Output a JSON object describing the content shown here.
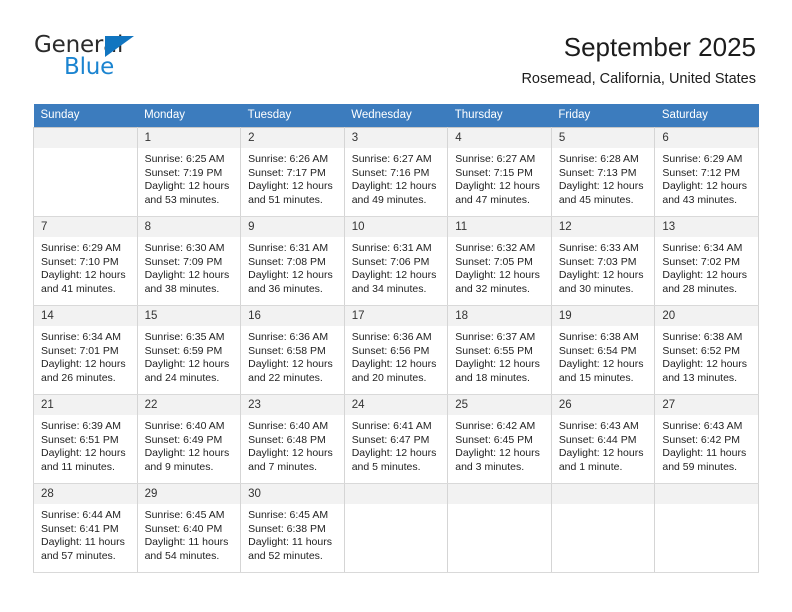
{
  "brand": {
    "name_part1": "General",
    "name_part2": "Blue",
    "accent_color": "#1b84d0",
    "triangle_color": "#1175c0"
  },
  "header": {
    "title": "September 2025",
    "subtitle": "Rosemead, California, United States"
  },
  "calendar": {
    "header_bg": "#3c7cbe",
    "daynum_bg": "#f2f2f2",
    "weekdays": [
      "Sunday",
      "Monday",
      "Tuesday",
      "Wednesday",
      "Thursday",
      "Friday",
      "Saturday"
    ],
    "weeks": [
      [
        {
          "day": "",
          "empty": true
        },
        {
          "day": "1",
          "sunrise": "Sunrise: 6:25 AM",
          "sunset": "Sunset: 7:19 PM",
          "daylight_line1": "Daylight: 12 hours",
          "daylight_line2": "and 53 minutes."
        },
        {
          "day": "2",
          "sunrise": "Sunrise: 6:26 AM",
          "sunset": "Sunset: 7:17 PM",
          "daylight_line1": "Daylight: 12 hours",
          "daylight_line2": "and 51 minutes."
        },
        {
          "day": "3",
          "sunrise": "Sunrise: 6:27 AM",
          "sunset": "Sunset: 7:16 PM",
          "daylight_line1": "Daylight: 12 hours",
          "daylight_line2": "and 49 minutes."
        },
        {
          "day": "4",
          "sunrise": "Sunrise: 6:27 AM",
          "sunset": "Sunset: 7:15 PM",
          "daylight_line1": "Daylight: 12 hours",
          "daylight_line2": "and 47 minutes."
        },
        {
          "day": "5",
          "sunrise": "Sunrise: 6:28 AM",
          "sunset": "Sunset: 7:13 PM",
          "daylight_line1": "Daylight: 12 hours",
          "daylight_line2": "and 45 minutes."
        },
        {
          "day": "6",
          "sunrise": "Sunrise: 6:29 AM",
          "sunset": "Sunset: 7:12 PM",
          "daylight_line1": "Daylight: 12 hours",
          "daylight_line2": "and 43 minutes."
        }
      ],
      [
        {
          "day": "7",
          "sunrise": "Sunrise: 6:29 AM",
          "sunset": "Sunset: 7:10 PM",
          "daylight_line1": "Daylight: 12 hours",
          "daylight_line2": "and 41 minutes."
        },
        {
          "day": "8",
          "sunrise": "Sunrise: 6:30 AM",
          "sunset": "Sunset: 7:09 PM",
          "daylight_line1": "Daylight: 12 hours",
          "daylight_line2": "and 38 minutes."
        },
        {
          "day": "9",
          "sunrise": "Sunrise: 6:31 AM",
          "sunset": "Sunset: 7:08 PM",
          "daylight_line1": "Daylight: 12 hours",
          "daylight_line2": "and 36 minutes."
        },
        {
          "day": "10",
          "sunrise": "Sunrise: 6:31 AM",
          "sunset": "Sunset: 7:06 PM",
          "daylight_line1": "Daylight: 12 hours",
          "daylight_line2": "and 34 minutes."
        },
        {
          "day": "11",
          "sunrise": "Sunrise: 6:32 AM",
          "sunset": "Sunset: 7:05 PM",
          "daylight_line1": "Daylight: 12 hours",
          "daylight_line2": "and 32 minutes."
        },
        {
          "day": "12",
          "sunrise": "Sunrise: 6:33 AM",
          "sunset": "Sunset: 7:03 PM",
          "daylight_line1": "Daylight: 12 hours",
          "daylight_line2": "and 30 minutes."
        },
        {
          "day": "13",
          "sunrise": "Sunrise: 6:34 AM",
          "sunset": "Sunset: 7:02 PM",
          "daylight_line1": "Daylight: 12 hours",
          "daylight_line2": "and 28 minutes."
        }
      ],
      [
        {
          "day": "14",
          "sunrise": "Sunrise: 6:34 AM",
          "sunset": "Sunset: 7:01 PM",
          "daylight_line1": "Daylight: 12 hours",
          "daylight_line2": "and 26 minutes."
        },
        {
          "day": "15",
          "sunrise": "Sunrise: 6:35 AM",
          "sunset": "Sunset: 6:59 PM",
          "daylight_line1": "Daylight: 12 hours",
          "daylight_line2": "and 24 minutes."
        },
        {
          "day": "16",
          "sunrise": "Sunrise: 6:36 AM",
          "sunset": "Sunset: 6:58 PM",
          "daylight_line1": "Daylight: 12 hours",
          "daylight_line2": "and 22 minutes."
        },
        {
          "day": "17",
          "sunrise": "Sunrise: 6:36 AM",
          "sunset": "Sunset: 6:56 PM",
          "daylight_line1": "Daylight: 12 hours",
          "daylight_line2": "and 20 minutes."
        },
        {
          "day": "18",
          "sunrise": "Sunrise: 6:37 AM",
          "sunset": "Sunset: 6:55 PM",
          "daylight_line1": "Daylight: 12 hours",
          "daylight_line2": "and 18 minutes."
        },
        {
          "day": "19",
          "sunrise": "Sunrise: 6:38 AM",
          "sunset": "Sunset: 6:54 PM",
          "daylight_line1": "Daylight: 12 hours",
          "daylight_line2": "and 15 minutes."
        },
        {
          "day": "20",
          "sunrise": "Sunrise: 6:38 AM",
          "sunset": "Sunset: 6:52 PM",
          "daylight_line1": "Daylight: 12 hours",
          "daylight_line2": "and 13 minutes."
        }
      ],
      [
        {
          "day": "21",
          "sunrise": "Sunrise: 6:39 AM",
          "sunset": "Sunset: 6:51 PM",
          "daylight_line1": "Daylight: 12 hours",
          "daylight_line2": "and 11 minutes."
        },
        {
          "day": "22",
          "sunrise": "Sunrise: 6:40 AM",
          "sunset": "Sunset: 6:49 PM",
          "daylight_line1": "Daylight: 12 hours",
          "daylight_line2": "and 9 minutes."
        },
        {
          "day": "23",
          "sunrise": "Sunrise: 6:40 AM",
          "sunset": "Sunset: 6:48 PM",
          "daylight_line1": "Daylight: 12 hours",
          "daylight_line2": "and 7 minutes."
        },
        {
          "day": "24",
          "sunrise": "Sunrise: 6:41 AM",
          "sunset": "Sunset: 6:47 PM",
          "daylight_line1": "Daylight: 12 hours",
          "daylight_line2": "and 5 minutes."
        },
        {
          "day": "25",
          "sunrise": "Sunrise: 6:42 AM",
          "sunset": "Sunset: 6:45 PM",
          "daylight_line1": "Daylight: 12 hours",
          "daylight_line2": "and 3 minutes."
        },
        {
          "day": "26",
          "sunrise": "Sunrise: 6:43 AM",
          "sunset": "Sunset: 6:44 PM",
          "daylight_line1": "Daylight: 12 hours",
          "daylight_line2": "and 1 minute."
        },
        {
          "day": "27",
          "sunrise": "Sunrise: 6:43 AM",
          "sunset": "Sunset: 6:42 PM",
          "daylight_line1": "Daylight: 11 hours",
          "daylight_line2": "and 59 minutes."
        }
      ],
      [
        {
          "day": "28",
          "sunrise": "Sunrise: 6:44 AM",
          "sunset": "Sunset: 6:41 PM",
          "daylight_line1": "Daylight: 11 hours",
          "daylight_line2": "and 57 minutes."
        },
        {
          "day": "29",
          "sunrise": "Sunrise: 6:45 AM",
          "sunset": "Sunset: 6:40 PM",
          "daylight_line1": "Daylight: 11 hours",
          "daylight_line2": "and 54 minutes."
        },
        {
          "day": "30",
          "sunrise": "Sunrise: 6:45 AM",
          "sunset": "Sunset: 6:38 PM",
          "daylight_line1": "Daylight: 11 hours",
          "daylight_line2": "and 52 minutes."
        },
        {
          "day": "",
          "empty": true
        },
        {
          "day": "",
          "empty": true
        },
        {
          "day": "",
          "empty": true
        },
        {
          "day": "",
          "empty": true
        }
      ]
    ]
  }
}
